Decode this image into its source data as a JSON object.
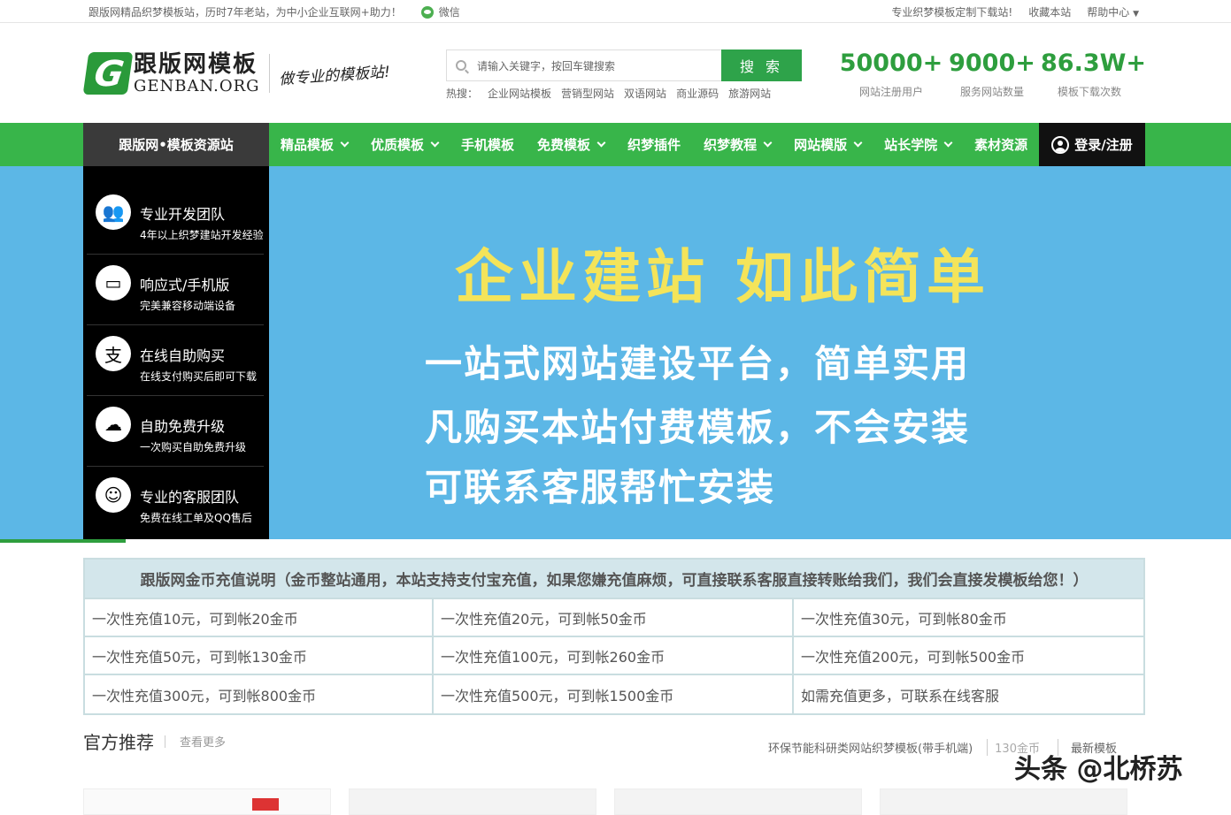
{
  "topbar": {
    "intro": "跟版网精品织梦模板站，历时7年老站，为中小企业互联网+助力！",
    "wechat": "微信",
    "custom": "专业织梦模板定制下载站!",
    "bookmark": "收藏本站",
    "help": "帮助中心"
  },
  "logo": {
    "cn": "跟版网模板",
    "en": "GENBAN.ORG",
    "slogan": "做专业的模板站!"
  },
  "search": {
    "placeholder": "请输入关键字，按回车键搜索",
    "button": "搜 索",
    "hot_label": "热搜：",
    "hot": [
      "企业网站模板",
      "营销型网站",
      "双语网站",
      "商业源码",
      "旅游网站"
    ]
  },
  "stats": [
    {
      "num": "50000+",
      "label": "网站注册用户"
    },
    {
      "num": "9000+",
      "label": "服务网站数量"
    },
    {
      "num": "86.3W+",
      "label": "模板下载次数"
    }
  ],
  "nav": {
    "brand": "跟版网•模板资源站",
    "items": [
      "精品模板",
      "优质模板",
      "手机模板",
      "免费模板",
      "织梦插件",
      "织梦教程",
      "网站模版",
      "站长学院",
      "素材资源"
    ],
    "login": "登录/注册"
  },
  "features": [
    {
      "title": "专业开发团队",
      "sub": "4年以上织梦建站开发经验",
      "icon": "team-icon"
    },
    {
      "title": "响应式/手机版",
      "sub": "完美兼容移动端设备",
      "icon": "responsive-icon"
    },
    {
      "title": "在线自助购买",
      "sub": "在线支付购买后即可下载",
      "icon": "alipay-icon"
    },
    {
      "title": "自助免费升级",
      "sub": "一次购买自助免费升级",
      "icon": "cloud-upgrade-icon"
    },
    {
      "title": "专业的客服团队",
      "sub": "免费在线工单及QQ售后",
      "icon": "support-icon"
    }
  ],
  "banner": {
    "headline": "企业建站 如此简单",
    "line1": "一站式网站建设平台，简单实用",
    "line2": "凡购买本站付费模板，不会安装",
    "line3": "可联系客服帮忙安装"
  },
  "recharge": {
    "title": "跟版网金币充值说明（金币整站通用，本站支持支付宝充值，如果您嫌充值麻烦，可直接联系客服直接转账给我们，我们会直接发模板给您！）",
    "rows": [
      [
        "一次性充值10元，可到帐20金币",
        "一次性充值20元，可到帐50金币",
        "一次性充值30元，可到帐80金币"
      ],
      [
        "一次性充值50元，可到帐130金币",
        "一次性充值100元，可到帐260金币",
        "一次性充值200元，可到帐500金币"
      ],
      [
        "一次性充值300元，可到帐800金币",
        "一次性充值500元，可到帐1500金币",
        "如需充值更多，可联系在线客服"
      ]
    ]
  },
  "official": {
    "title": "官方推荐",
    "more": "查看更多"
  },
  "latest": {
    "item": "环保节能科研类网站织梦模板(带手机端)",
    "price": "130金币",
    "label": "最新模板"
  },
  "watermark": "头条 @北桥苏",
  "colors": {
    "green": "#38b54a",
    "banner_bg": "#5cb7e6",
    "headline": "#f4e45a"
  }
}
